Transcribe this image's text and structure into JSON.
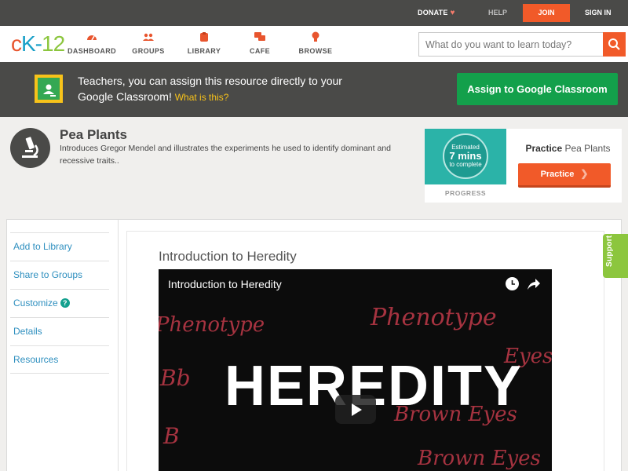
{
  "topbar": {
    "donate": "DONATE",
    "help": "HELP",
    "join": "JOIN",
    "signin": "SIGN IN"
  },
  "logo": {
    "c": "c",
    "k": "K-",
    "n": "12"
  },
  "nav": {
    "items": [
      {
        "label": "DASHBOARD",
        "icon": "dashboard-icon"
      },
      {
        "label": "GROUPS",
        "icon": "groups-icon"
      },
      {
        "label": "LIBRARY",
        "icon": "library-icon"
      },
      {
        "label": "CAFE",
        "icon": "cafe-icon"
      },
      {
        "label": "BROWSE",
        "icon": "browse-icon"
      }
    ],
    "search_placeholder": "What do you want to learn today?"
  },
  "banner": {
    "text": "Teachers, you can assign this resource directly to your Google Classroom!",
    "what": "What is this?",
    "button": "Assign to Google Classroom"
  },
  "concept": {
    "title": "Pea Plants",
    "description": "Introduces Gregor Mendel and illustrates the experiments he used to identify dominant and recessive traits.."
  },
  "practice": {
    "estimated": "Estimated",
    "mins": "7 mins",
    "to_complete": "to complete",
    "progress_label": "PROGRESS",
    "title_bold": "Practice",
    "title_rest": "Pea Plants",
    "button": "Practice"
  },
  "sidebar": {
    "items": [
      {
        "label": "Add to Library"
      },
      {
        "label": "Share to Groups"
      },
      {
        "label": "Customize"
      },
      {
        "label": "Details"
      },
      {
        "label": "Resources"
      }
    ]
  },
  "video": {
    "heading": "Introduction to Heredity",
    "player_title": "Introduction to Heredity",
    "big_text": "HEREDITY",
    "bg_words": [
      "Phenotype",
      "Phenotype",
      "Bb",
      "Eyes",
      "Brown Eyes",
      "Brown Eyes",
      "B"
    ]
  },
  "support": "Support",
  "colors": {
    "accent_orange": "#f15a29",
    "google_green": "#13a04b",
    "link_blue": "#2e8fbf",
    "support_green": "#8cc63e"
  }
}
